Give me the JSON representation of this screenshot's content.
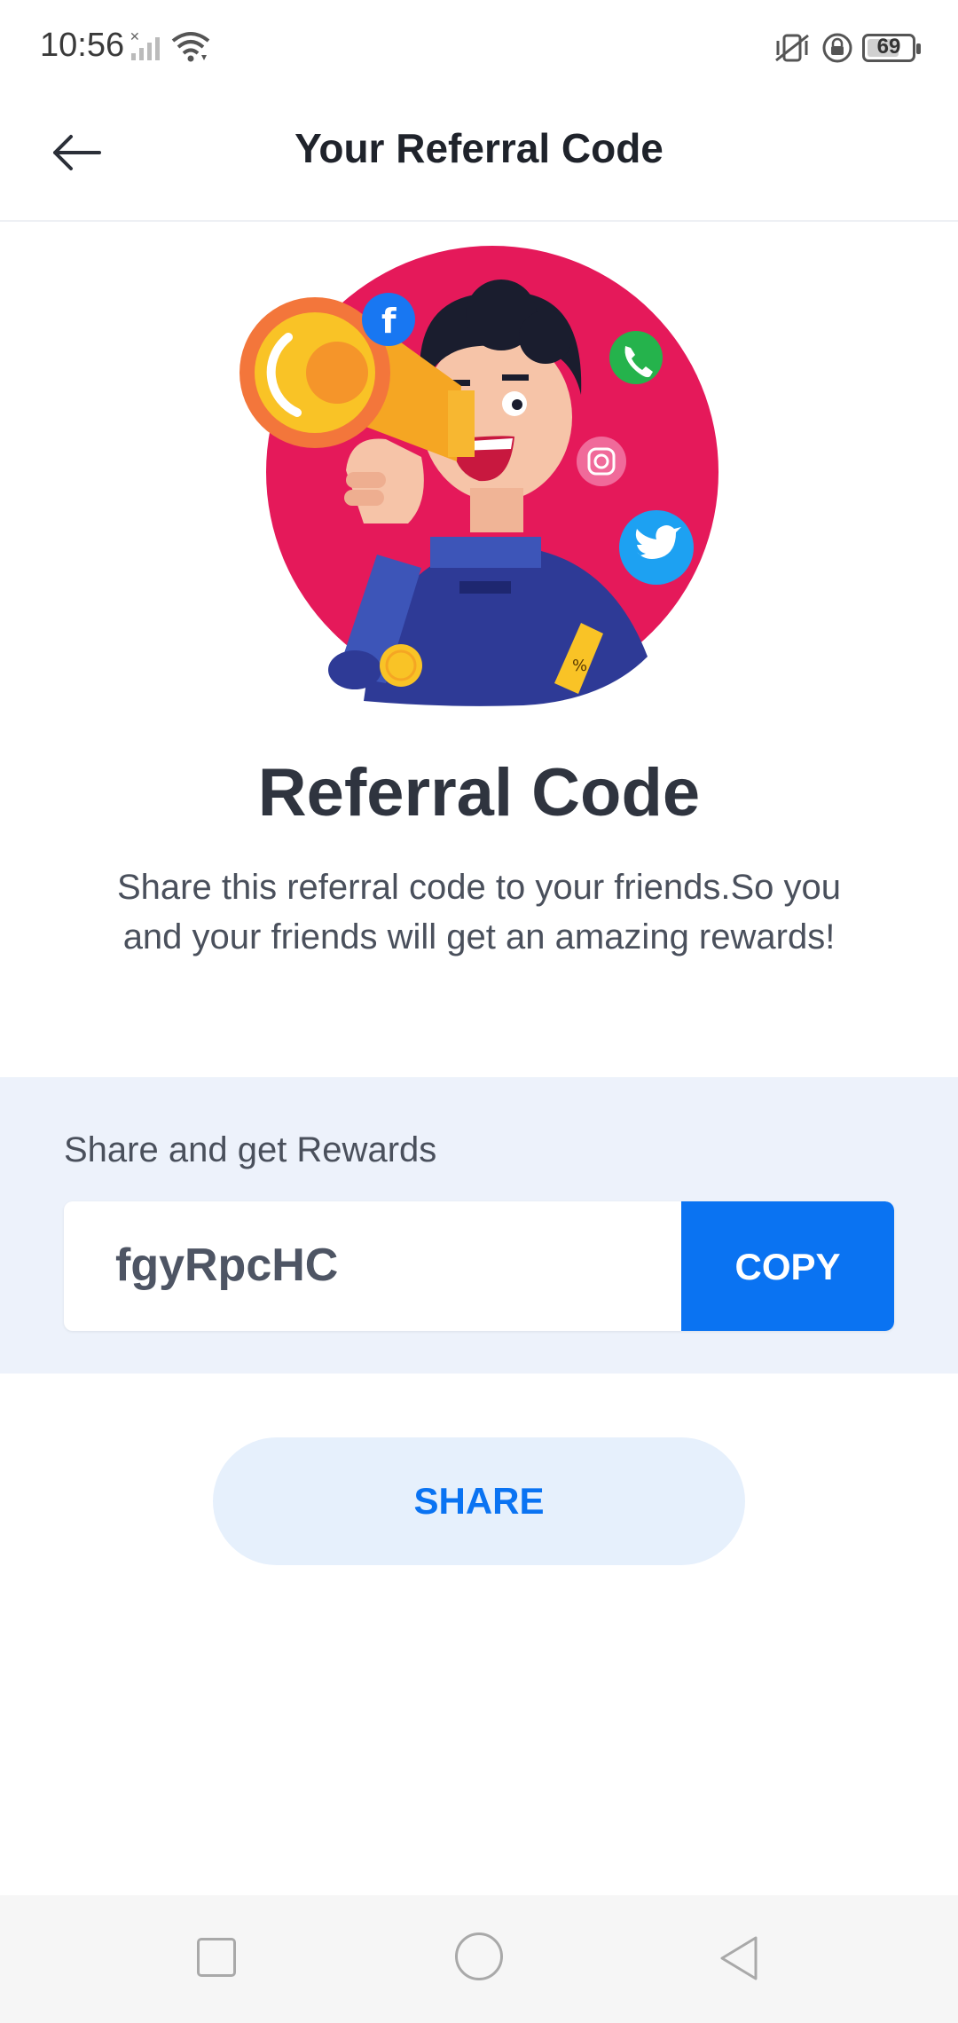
{
  "status_bar": {
    "time": "10:56",
    "battery": "69"
  },
  "app_bar": {
    "title": "Your Referral Code"
  },
  "content": {
    "heading": "Referral Code",
    "description": "Share this referral code to your friends.So you and your friends will get an amazing rewards!"
  },
  "reward": {
    "label": "Share and get Rewards",
    "code": "fgyRpcHC",
    "copy_label": "COPY"
  },
  "share_label": "SHARE",
  "colors": {
    "accent": "#0a73f2",
    "panel_bg": "#edf2fb",
    "share_bg": "#e6f0fc",
    "illustration_circle": "#e5195a"
  }
}
